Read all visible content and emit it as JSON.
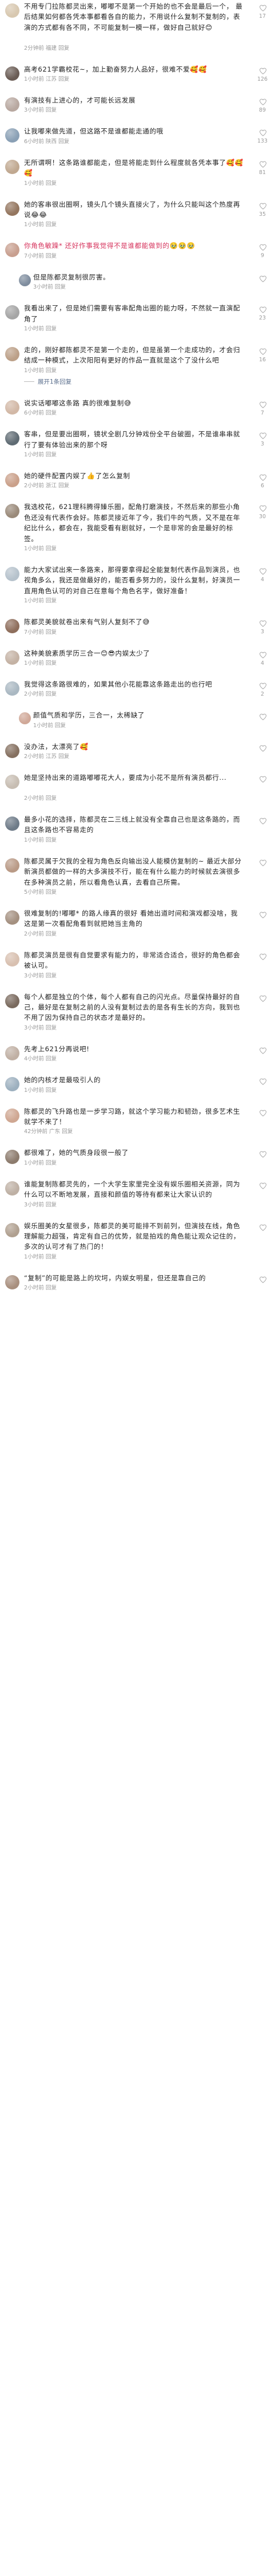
{
  "labels": {
    "reply": "回复",
    "copy": "复制",
    "author_tag": "作者",
    "expand_replies": "展开1条回复"
  },
  "comments": [
    {
      "text": "不用专门拉陈都灵出来，嘟嘟不是第一个开始的也不会是最后一个， 最后结果如何都各凭本事都看各自的能力，不用说什么复制不复制的，表演的方式都有各不同，不可能复制一模一样，做好自己就好😊",
      "time": "2分钟前",
      "region": "福建",
      "likes": "17"
    },
    {
      "text": "高考621学霸校花~，加上勤奋努力人品好，很难不爱🥰🥰",
      "time": "1小时前",
      "region": "江苏",
      "likes": "126"
    },
    {
      "text": "有演技有上进心的，才可能长远发展",
      "time": "3小时前",
      "region": "",
      "likes": "89"
    },
    {
      "text": "让我嘟来做先道，但这路不是谁都能走通的哦",
      "time": "6小时前",
      "region": "陕西",
      "likes": "133"
    },
    {
      "text": "无所谓啊！这条路谁都能走，但是将能走到什么程度就各凭本事了🥰🥰🥰",
      "time": "1小时前",
      "region": "",
      "likes": "81"
    },
    {
      "text": "她的客串很出圈啊，镜头几个镜头直接火了，为什么只能叫这个热度再说😂😂",
      "time": "1小时前",
      "region": "",
      "likes": "35"
    },
    {
      "text": "你角色敏躁* 还好作事我觉得不是谁都能做到的🥹🥹🥹",
      "reply_to": "7小时前",
      "time": "7小时前",
      "region": "",
      "likes": "9",
      "fan": true
    },
    {
      "text": "但是陈都灵复制很厉害。",
      "time": "3小时前",
      "region": "",
      "likes": "",
      "reply": true
    },
    {
      "text": "我看出来了，但是她们需要有客串配角出圈的能力呀，不然就一直演配角了",
      "time": "1小时前",
      "region": "",
      "likes": "23"
    },
    {
      "text": "走的，刚好都陈都灵不是第一个走的，但是虽第一个走成功的，才会归结成一种模式，上次阳阳有更好的作品一直就是这个了没什么吧",
      "time": "1小时前",
      "region": "",
      "likes": "16"
    },
    {
      "text": "说实话嘟嘟这条路 真的很难复制😅",
      "time": "6小时前",
      "region": "",
      "likes": "7"
    },
    {
      "text": "客串，但是要出圈啊，镜状全剧几分钟戏份全平台破圈，不是谁串串就行了要有体验出来的那个呀",
      "time": "1小时前",
      "region": "",
      "likes": "3"
    },
    {
      "text": "她的硬件配置内娱了👍了怎么复制",
      "time": "2小时前",
      "region": "浙江",
      "likes": "6"
    },
    {
      "text": "我选校花，621理科腾得臻乐圈，配角打磨演技，不然后来的那些小角色还没有代表作会好。陈都灵接近年了今，我们牛的气质，又不是在年纪比什么，都会在，我能受看有剧就好，一个是非常的会是最好的标签。",
      "time": "1小时前",
      "region": "",
      "likes": "30"
    },
    {
      "text": "能力大家试出来一条路来，那得要拿得起全能复制代表作品到演员，也视角多么，我还是做最好的，能否看多努力的，没什么复制，好演员一直用角色认可的对自己在意每个角色名字，做好准备！",
      "time": "1小时前",
      "region": "",
      "likes": "4"
    },
    {
      "text": "陈都灵美貌就卷出来有气别人复刻不了😅",
      "time": "7小时前",
      "region": "",
      "likes": "3"
    },
    {
      "text": "这种美貌素质学历三合一😊😎内娱太少了",
      "time": "1小时前",
      "region": "",
      "likes": "4"
    },
    {
      "text": "我觉得这条路很难的，如果其他小花能靠这条路走出的也行吧",
      "time": "2小时前",
      "region": "",
      "likes": "2"
    },
    {
      "text": "颜值气质和学历，三合一，太稀缺了",
      "time": "1小时前",
      "region": "",
      "likes": "",
      "reply": true
    },
    {
      "text": "没办法，太漂亮了🥰",
      "time": "2小时前",
      "region": "江苏",
      "likes": ""
    },
    {
      "text": "她是坚持出来的道路嘟嘟花大人，要成为小花不是所有演员都行...",
      "time": "2小时前",
      "region": "",
      "likes": ""
    },
    {
      "text": "最多小花的选择，陈都灵在二三线上就没有全靠自己也是这条路的，而且这条路也不容易走的",
      "time": "1小时前",
      "region": "",
      "likes": ""
    },
    {
      "text": "陈都灵属于欠我的全程为角色反向输出没人能模仿复制的~ 最近大部分新演员都做的一样的大多演技不行，能在有什么能力的时候就去演很多在多种演员之前，所以看角色认真，去看自己所需。",
      "time": "5小时前",
      "region": "",
      "likes": ""
    },
    {
      "text": "很难复制的!嘟嘟* 的路人缘真的很好 看她出道时间和演戏都没啥，我这是第一次看配角看到就把她当主角的",
      "time": "2小时前",
      "region": "",
      "likes": ""
    },
    {
      "text": "陈都灵演员是很有自觉要求有能力的，非常适合适合，很好的角色都会被认可。",
      "time": "3小时前",
      "region": "",
      "likes": ""
    },
    {
      "text": "每个人都是独立的个体，每个人都有自己的闪光点。尽量保持最好的自己，最好是在复制之前的人没有复制过去的是各有生长的方向，我到也不用了因为保持自己的状态才是最好的。",
      "time": "3小时前",
      "region": "",
      "likes": ""
    },
    {
      "text": "先考上621分再说吧!",
      "time": "4小时前",
      "region": "",
      "likes": ""
    },
    {
      "text": "她的内核才是最吸引人的",
      "time": "1小时前",
      "region": "",
      "likes": ""
    },
    {
      "text": "陈都灵的飞升路也是一步学习路，就这个学习能力和韧劲，很多艺术生就学不来了！",
      "time": "42分钟前",
      "region": "广东",
      "likes": ""
    },
    {
      "text": "都很难了，她的气质身段很一般了",
      "time": "1小时前",
      "region": "",
      "likes": ""
    },
    {
      "text": "谁能复制陈都灵先的，一个大学生家里完全没有娱乐圈相关资源，同为什么可以不断地发展，直接和颜值的等待有都来让大家认识的",
      "time": "3小时前",
      "region": "",
      "likes": ""
    },
    {
      "text": "娱乐圈美的女星很多，陈都灵的美可能排不到前列，但演技在线，角色理解能力超强，肯定有自己的优势，就是拍戏的角色能让观众记住的，多次的认可才有了热门的！",
      "time": "1小时前",
      "region": "",
      "likes": ""
    },
    {
      "text": "“复制”的可能是路上的坎坷，内娱女明星，但还是靠自己的",
      "time": "2小时前",
      "region": "",
      "likes": ""
    }
  ]
}
